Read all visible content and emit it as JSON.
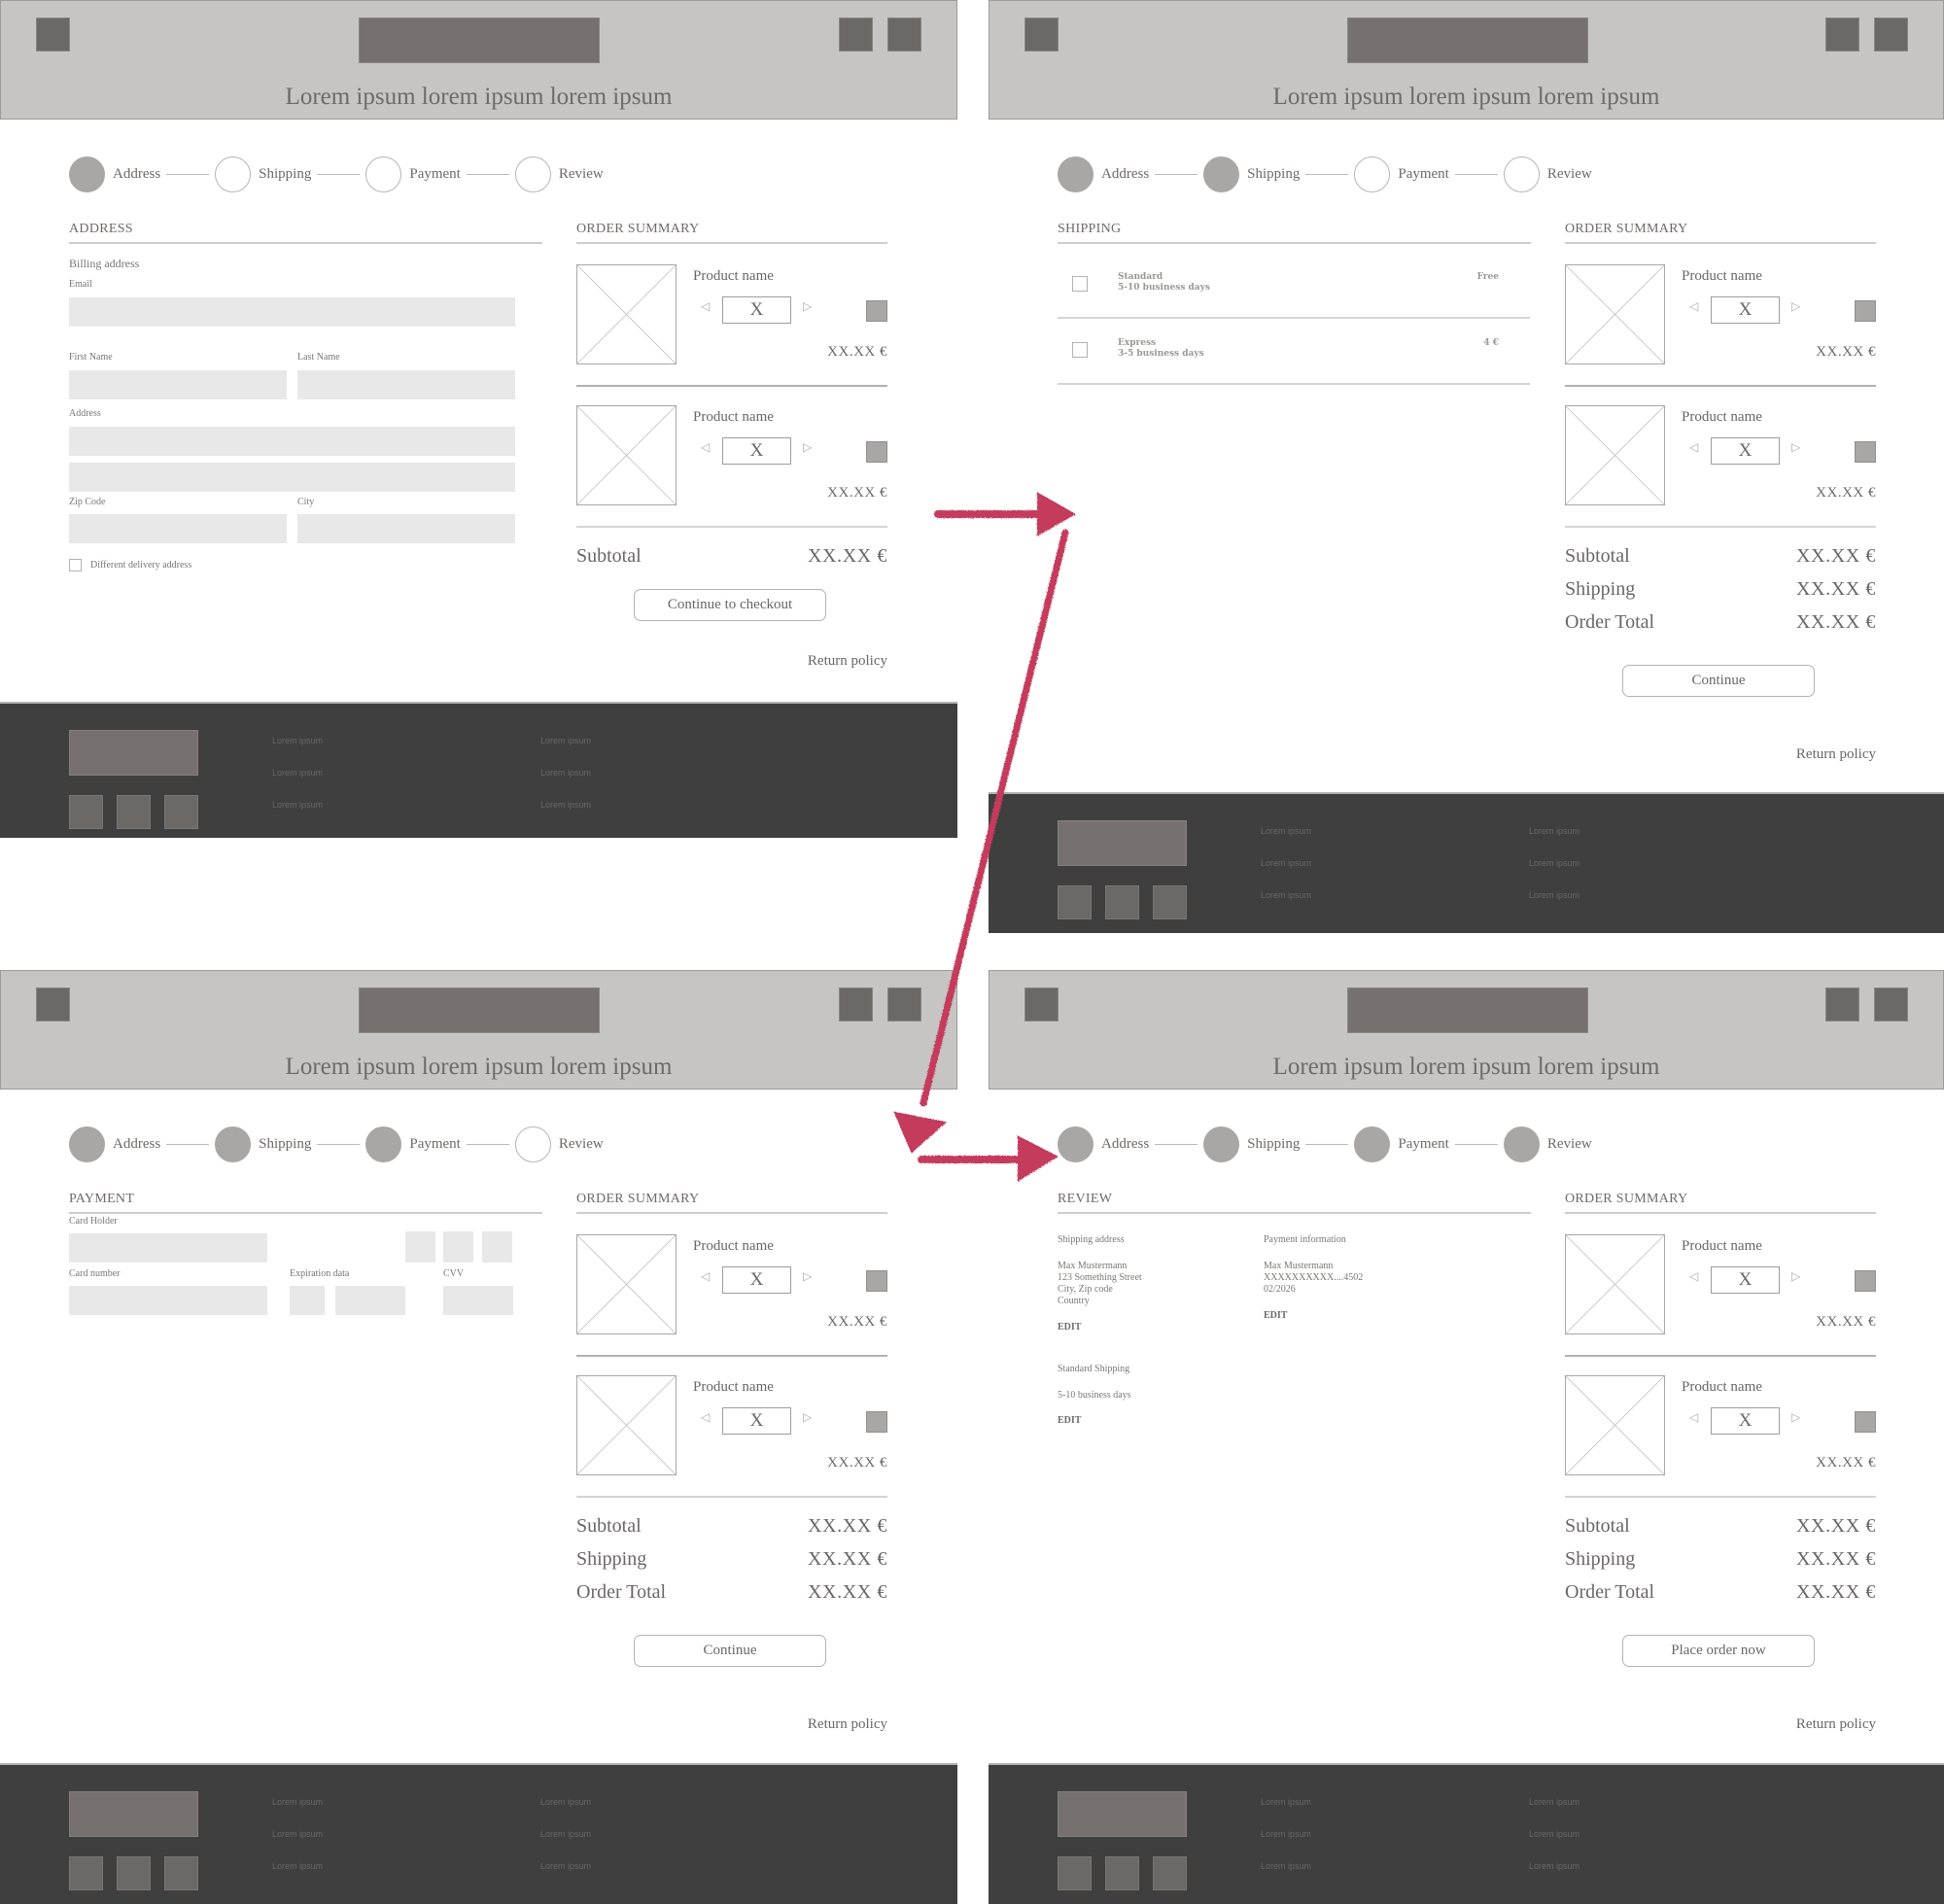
{
  "header": {
    "title": "Lorem ipsum lorem ipsum lorem ipsum"
  },
  "stepper": {
    "steps": [
      "Address",
      "Shipping",
      "Payment",
      "Review"
    ]
  },
  "address": {
    "section_title": "ADDRESS",
    "subtitle": "Billing address",
    "labels": {
      "email": "Email",
      "first_name": "First Name",
      "last_name": "Last Name",
      "address": "Address",
      "zip": "Zip Code",
      "city": "City"
    },
    "different_delivery": "Different delivery address"
  },
  "shipping": {
    "section_title": "SHIPPING",
    "options": [
      {
        "name": "Standard",
        "days": "5-10 business days",
        "price": "Free"
      },
      {
        "name": "Express",
        "days": "3-5 business days",
        "price": "4 €"
      }
    ]
  },
  "payment": {
    "section_title": "PAYMENT",
    "labels": {
      "card_holder": "Card Holder",
      "card_number": "Card number",
      "expiration": "Expiration data",
      "cvv": "CVV"
    }
  },
  "review": {
    "section_title": "REVIEW",
    "shipping_address": {
      "heading": "Shipping address",
      "lines": [
        "Max Mustermann",
        "123 Something Street",
        "City, Zip code",
        "Country"
      ],
      "edit": "EDIT"
    },
    "payment_info": {
      "heading": "Payment information",
      "lines": [
        "Max Mustermann",
        "XXXXXXXXXX....4502",
        "02/2026"
      ],
      "edit": "EDIT"
    },
    "shipping_method": {
      "name": "Standard Shipping",
      "days": "5-10 business days",
      "edit": "EDIT"
    }
  },
  "order_summary": {
    "title": "ORDER SUMMARY",
    "products": [
      {
        "name": "Product name",
        "qty": "X",
        "price": "XX.XX €"
      },
      {
        "name": "Product name",
        "qty": "X",
        "price": "XX.XX €"
      }
    ],
    "subtotal_label": "Subtotal",
    "shipping_label": "Shipping",
    "total_label": "Order Total",
    "amount": "XX.XX €",
    "return_policy": "Return policy"
  },
  "buttons": {
    "checkout": "Continue to checkout",
    "continue": "Continue",
    "place_order": "Place order now"
  },
  "footer": {
    "links_col1": [
      "Lorem ipsum",
      "Lorem ipsum",
      "Lorem ipsum"
    ],
    "links_col2": [
      "Lorem ipsum",
      "Lorem ipsum",
      "Lorem ipsum"
    ]
  },
  "colors": {
    "arrow": "#c43a5c",
    "header_bg": "#c6c5c3",
    "footer_bg": "#3f3f3f",
    "step_done": "#a9a7a5",
    "field_bg": "#e8e8e8"
  },
  "flow": [
    "Address",
    "Shipping",
    "Payment",
    "Review"
  ]
}
